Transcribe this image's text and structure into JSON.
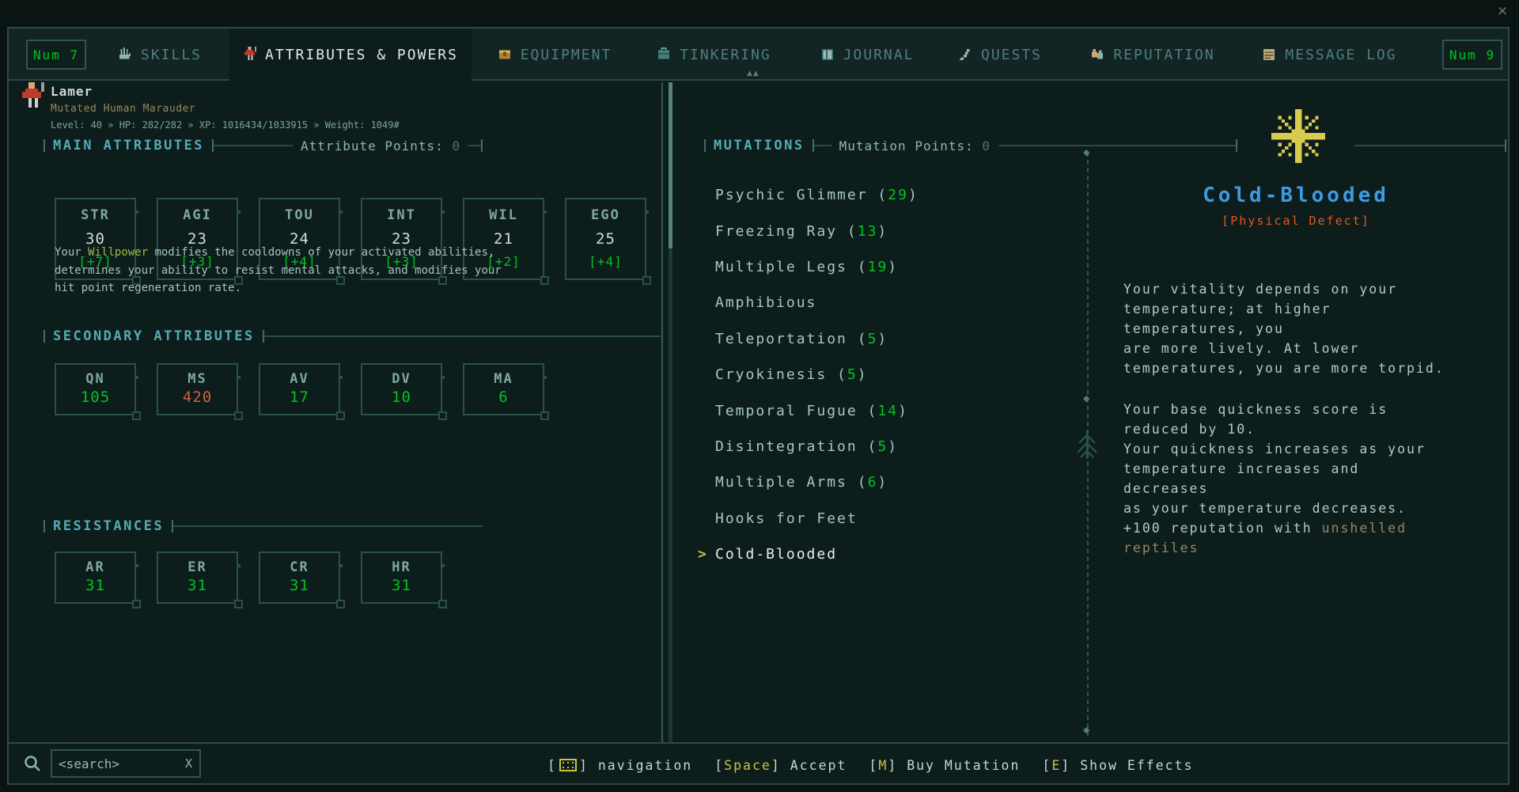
{
  "window": {
    "close_glyph": "×",
    "scroll_up_glyph": "▲▲",
    "separator_diamond": "◆"
  },
  "tabbar": {
    "left_pager": "Num 7",
    "right_pager": "Num 9",
    "tabs": [
      {
        "label": "SKILLS"
      },
      {
        "label": "ATTRIBUTES & POWERS"
      },
      {
        "label": "EQUIPMENT"
      },
      {
        "label": "TINKERING"
      },
      {
        "label": "JOURNAL"
      },
      {
        "label": "QUESTS"
      },
      {
        "label": "REPUTATION"
      },
      {
        "label": "MESSAGE LOG"
      }
    ]
  },
  "character": {
    "name": "Lamer",
    "subtitle": "Mutated Human Marauder",
    "stats_line": "Level: 40 » HP: 282/282 » XP: 1016434/1033915 » Weight: 1049#"
  },
  "main_attributes": {
    "title": "MAIN ATTRIBUTES",
    "points_label": "Attribute Points:",
    "points_value": "0",
    "attributes": [
      {
        "abbr": "STR",
        "value": "30",
        "bonus": "[+7]"
      },
      {
        "abbr": "AGI",
        "value": "23",
        "bonus": "[+3]"
      },
      {
        "abbr": "TOU",
        "value": "24",
        "bonus": "[+4]"
      },
      {
        "abbr": "INT",
        "value": "23",
        "bonus": "[+3]"
      },
      {
        "abbr": "WIL",
        "value": "21",
        "bonus": "[+2]"
      },
      {
        "abbr": "EGO",
        "value": "25",
        "bonus": "[+4]"
      }
    ],
    "description": {
      "pre": "Your ",
      "highlight": "Willpower",
      "post": " modifies the cooldowns of your activated abilities,\ndetermines your ability to resist mental attacks, and modifies your\nhit point regeneration rate."
    }
  },
  "secondary_attributes": {
    "title": "SECONDARY ATTRIBUTES",
    "attributes": [
      {
        "abbr": "QN",
        "value": "105",
        "color": "green"
      },
      {
        "abbr": "MS",
        "value": "420",
        "color": "red"
      },
      {
        "abbr": "AV",
        "value": "17",
        "color": "green"
      },
      {
        "abbr": "DV",
        "value": "10",
        "color": "green"
      },
      {
        "abbr": "MA",
        "value": "6",
        "color": "green"
      }
    ]
  },
  "resistances": {
    "title": "RESISTANCES",
    "attributes": [
      {
        "abbr": "AR",
        "value": "31",
        "color": "green"
      },
      {
        "abbr": "ER",
        "value": "31",
        "color": "green"
      },
      {
        "abbr": "CR",
        "value": "31",
        "color": "green"
      },
      {
        "abbr": "HR",
        "value": "31",
        "color": "green"
      }
    ]
  },
  "mutations": {
    "title": "MUTATIONS",
    "points_label": "Mutation Points:",
    "points_value": "0",
    "items": [
      {
        "cursor": "",
        "name": "Psychic Glimmer",
        "open": " (",
        "level": "29",
        "close": ")",
        "state": ""
      },
      {
        "cursor": "",
        "name": "Freezing Ray",
        "open": " (",
        "level": "13",
        "close": ")",
        "state": ""
      },
      {
        "cursor": "",
        "name": "Multiple Legs",
        "open": " (",
        "level": "19",
        "close": ")",
        "state": ""
      },
      {
        "cursor": "",
        "name": "Amphibious",
        "open": "",
        "level": "",
        "close": "",
        "state": ""
      },
      {
        "cursor": "",
        "name": "Teleportation",
        "open": " (",
        "level": "5",
        "close": ")",
        "state": ""
      },
      {
        "cursor": "",
        "name": "Cryokinesis",
        "open": " (",
        "level": "5",
        "close": ")",
        "state": ""
      },
      {
        "cursor": "",
        "name": "Temporal Fugue",
        "open": " (",
        "level": "14",
        "close": ")",
        "state": ""
      },
      {
        "cursor": "",
        "name": "Disintegration",
        "open": " (",
        "level": "5",
        "close": ")",
        "state": ""
      },
      {
        "cursor": "",
        "name": "Multiple Arms",
        "open": " (",
        "level": "6",
        "close": ")",
        "state": ""
      },
      {
        "cursor": "",
        "name": "Hooks for Feet",
        "open": "",
        "level": "",
        "close": "",
        "state": ""
      },
      {
        "cursor": ">",
        "name": "Cold-Blooded",
        "open": "",
        "level": "",
        "close": "",
        "state": "selected"
      }
    ]
  },
  "detail": {
    "title": "Cold-Blooded",
    "category": "[Physical Defect]",
    "paragraph1": "Your vitality depends on your\ntemperature; at higher\ntemperatures, you\nare more lively. At lower\ntemperatures, you are more torpid.",
    "paragraph2": "Your base quickness score is\nreduced by 10.\nYour quickness increases as your\ntemperature increases and\ndecreases\nas your temperature decreases.\n+100 reputation with ",
    "reputation_highlight": "unshelled\nreptiles"
  },
  "footer": {
    "bracket_open": "[",
    "bracket_close": "]",
    "search_placeholder": "<search>",
    "search_clear_label": "X",
    "hints": [
      {
        "key": "",
        "label": "navigation"
      },
      {
        "key": "Space",
        "label": "Accept"
      },
      {
        "key": "M",
        "label": "Buy Mutation"
      },
      {
        "key": "E",
        "label": "Show Effects"
      }
    ]
  },
  "icons": {
    "tab_skills": "hand",
    "tab_attributes": "character-sprite",
    "tab_equipment": "chest",
    "tab_tinkering": "toolbox",
    "tab_journal": "book",
    "tab_quests": "quill",
    "tab_reputation": "two-figures",
    "tab_message_log": "scroll",
    "search": "magnifier",
    "navigation": "keypad",
    "mutation_detail": "snowflake",
    "selection_cursor": ">"
  },
  "colors": {
    "background": "#0c1d1c",
    "panel_border": "#2b4a47",
    "header_cyan": "#56aab6",
    "text_light": "#a9c7c2",
    "text_dim": "#53736e",
    "green": "#00C420",
    "red": "#D0603F",
    "yellow": "#CFC041",
    "blue": "#3D9BE2",
    "orange": "#E2581E",
    "olive": "#98875F",
    "white": "#e9f1ef"
  }
}
